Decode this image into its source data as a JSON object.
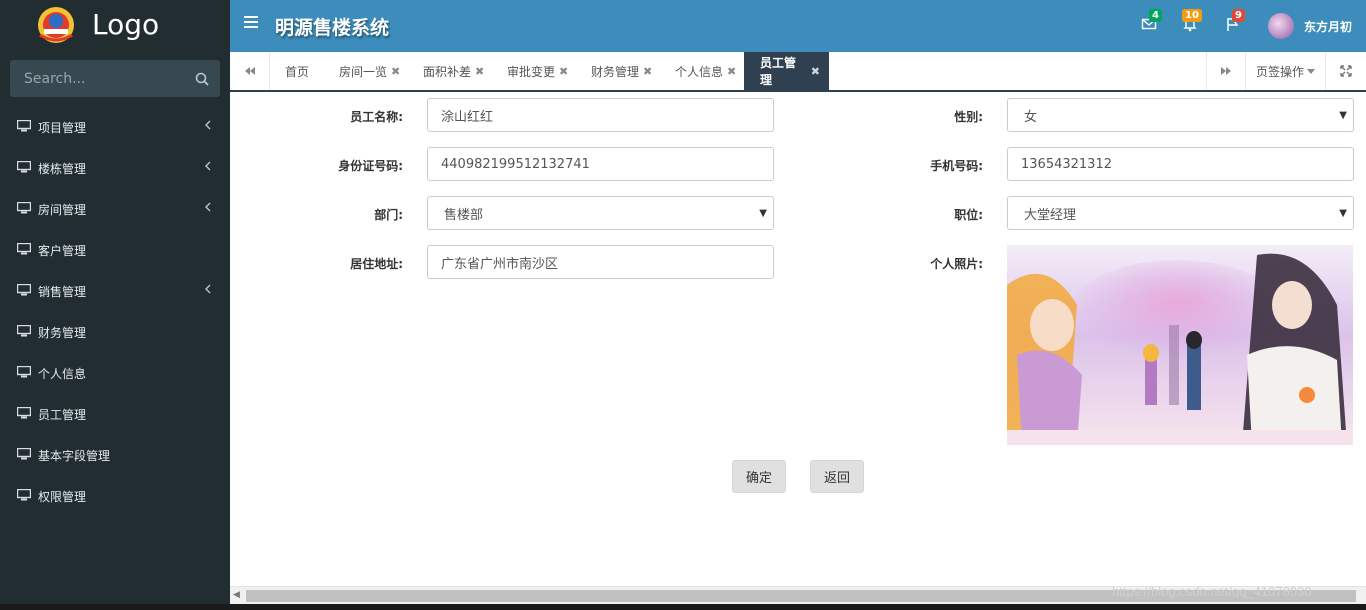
{
  "sidebar": {
    "logo_text": "Logo",
    "search_placeholder": "Search...",
    "items": [
      {
        "label": "项目管理",
        "has_submenu": true
      },
      {
        "label": "楼栋管理",
        "has_submenu": true
      },
      {
        "label": "房间管理",
        "has_submenu": true
      },
      {
        "label": "客户管理",
        "has_submenu": false
      },
      {
        "label": "销售管理",
        "has_submenu": true
      },
      {
        "label": "财务管理",
        "has_submenu": false
      },
      {
        "label": "个人信息",
        "has_submenu": false
      },
      {
        "label": "员工管理",
        "has_submenu": false
      },
      {
        "label": "基本字段管理",
        "has_submenu": false
      },
      {
        "label": "权限管理",
        "has_submenu": false
      }
    ]
  },
  "header": {
    "title": "明源售楼系统",
    "messages_count": "4",
    "notifications_count": "10",
    "flags_count": "9",
    "user_name": "东方月初"
  },
  "tabs": {
    "items": [
      "首页",
      "房间一览",
      "面积补差",
      "审批变更",
      "财务管理",
      "个人信息",
      "员工管理"
    ],
    "active": "员工管理",
    "page_actions_label": "页签操作"
  },
  "form": {
    "name_label": "员工名称:",
    "name_value": "涂山红红",
    "gender_label": "性别:",
    "gender_value": "女",
    "id_label": "身份证号码:",
    "id_value": "440982199512132741",
    "phone_label": "手机号码:",
    "phone_value": "13654321312",
    "dept_label": "部门:",
    "dept_value": "售楼部",
    "position_label": "职位:",
    "position_value": "大堂经理",
    "address_label": "居住地址:",
    "address_value": "广东省广州市南沙区",
    "photo_label": "个人照片:",
    "confirm_label": "确定",
    "back_label": "返回"
  },
  "watermark": "https://blog.csdn.net/qq_41078030",
  "colors": {
    "sidebar_bg": "#222d32",
    "header_bg": "#3c8dbc",
    "active_tab_bg": "#2f4050",
    "badge_green": "#00a65a",
    "badge_orange": "#f39c12",
    "badge_red": "#dd4b39"
  }
}
